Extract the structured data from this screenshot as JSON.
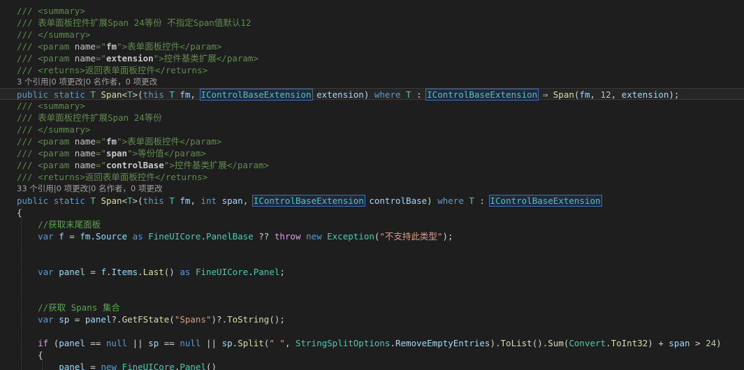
{
  "lines": [
    {
      "kind": "code",
      "tokens": [
        [
          "doc",
          "/// "
        ],
        [
          "tag",
          "<summary>"
        ]
      ]
    },
    {
      "kind": "code",
      "tokens": [
        [
          "doc",
          "/// 表单面板控件扩展Span 24等份 不指定Span值默认12"
        ]
      ]
    },
    {
      "kind": "code",
      "tokens": [
        [
          "doc",
          "/// "
        ],
        [
          "tag",
          "</summary>"
        ]
      ]
    },
    {
      "kind": "code",
      "tokens": [
        [
          "doc",
          "/// "
        ],
        [
          "tag",
          "<param "
        ],
        [
          "attr",
          "name"
        ],
        [
          "q",
          "=\""
        ],
        [
          "aval",
          "fm"
        ],
        [
          "q",
          "\""
        ],
        [
          "tag",
          ">"
        ],
        [
          "doc",
          "表单面板控件"
        ],
        [
          "tag",
          "</param>"
        ]
      ]
    },
    {
      "kind": "code",
      "tokens": [
        [
          "doc",
          "/// "
        ],
        [
          "tag",
          "<param "
        ],
        [
          "attr",
          "name"
        ],
        [
          "q",
          "=\""
        ],
        [
          "aval",
          "extension"
        ],
        [
          "q",
          "\""
        ],
        [
          "tag",
          ">"
        ],
        [
          "doc",
          "控件基类扩展"
        ],
        [
          "tag",
          "</param>"
        ]
      ]
    },
    {
      "kind": "code",
      "tokens": [
        [
          "doc",
          "/// "
        ],
        [
          "tag",
          "<returns>"
        ],
        [
          "doc",
          "返回表单面板控件"
        ],
        [
          "tag",
          "</returns>"
        ]
      ]
    },
    {
      "kind": "lens",
      "text": "3 个引用|0 项更改|0 名作者，0 项更改"
    },
    {
      "kind": "code",
      "current": true,
      "tokens": [
        [
          "kw",
          "public"
        ],
        [
          "pl",
          " "
        ],
        [
          "kw",
          "static"
        ],
        [
          "pl",
          " "
        ],
        [
          "ty",
          "T"
        ],
        [
          "pl",
          " "
        ],
        [
          "m",
          "Span"
        ],
        [
          "pl",
          "<"
        ],
        [
          "ty",
          "T"
        ],
        [
          "pl",
          ">("
        ],
        [
          "kw",
          "this"
        ],
        [
          "pl",
          " "
        ],
        [
          "ty",
          "T"
        ],
        [
          "pl",
          " "
        ],
        [
          "id",
          "fm"
        ],
        [
          "pl",
          ", "
        ],
        [
          "hl",
          "IControlBaseExtension"
        ],
        [
          "pl",
          " "
        ],
        [
          "id",
          "extension"
        ],
        [
          "pl",
          ") "
        ],
        [
          "kw",
          "where"
        ],
        [
          "pl",
          " "
        ],
        [
          "ty",
          "T"
        ],
        [
          "pl",
          " : "
        ],
        [
          "hl",
          "IControlBaseExtension"
        ],
        [
          "pl",
          " ⇒ "
        ],
        [
          "m",
          "Span"
        ],
        [
          "pl",
          "("
        ],
        [
          "id",
          "fm"
        ],
        [
          "pl",
          ", "
        ],
        [
          "num",
          "12"
        ],
        [
          "pl",
          ", "
        ],
        [
          "id",
          "extension"
        ],
        [
          "pl",
          ");"
        ]
      ]
    },
    {
      "kind": "code",
      "tokens": [
        [
          "doc",
          "/// "
        ],
        [
          "tag",
          "<summary>"
        ]
      ]
    },
    {
      "kind": "code",
      "tokens": [
        [
          "doc",
          "/// 表单面板控件扩展Span 24等份"
        ]
      ]
    },
    {
      "kind": "code",
      "tokens": [
        [
          "doc",
          "/// "
        ],
        [
          "tag",
          "</summary>"
        ]
      ]
    },
    {
      "kind": "code",
      "tokens": [
        [
          "doc",
          "/// "
        ],
        [
          "tag",
          "<param "
        ],
        [
          "attr",
          "name"
        ],
        [
          "q",
          "=\""
        ],
        [
          "aval",
          "fm"
        ],
        [
          "q",
          "\""
        ],
        [
          "tag",
          ">"
        ],
        [
          "doc",
          "表单面板控件"
        ],
        [
          "tag",
          "</param>"
        ]
      ]
    },
    {
      "kind": "code",
      "tokens": [
        [
          "doc",
          "/// "
        ],
        [
          "tag",
          "<param "
        ],
        [
          "attr",
          "name"
        ],
        [
          "q",
          "=\""
        ],
        [
          "aval",
          "span"
        ],
        [
          "q",
          "\""
        ],
        [
          "tag",
          ">"
        ],
        [
          "doc",
          "等份值"
        ],
        [
          "tag",
          "</param>"
        ]
      ]
    },
    {
      "kind": "code",
      "tokens": [
        [
          "doc",
          "/// "
        ],
        [
          "tag",
          "<param "
        ],
        [
          "attr",
          "name"
        ],
        [
          "q",
          "=\""
        ],
        [
          "aval",
          "controlBase"
        ],
        [
          "q",
          "\""
        ],
        [
          "tag",
          ">"
        ],
        [
          "doc",
          "控件基类扩展"
        ],
        [
          "tag",
          "</param>"
        ]
      ]
    },
    {
      "kind": "code",
      "tokens": [
        [
          "doc",
          "/// "
        ],
        [
          "tag",
          "<returns>"
        ],
        [
          "doc",
          "返回表单面板控件"
        ],
        [
          "tag",
          "</returns>"
        ]
      ]
    },
    {
      "kind": "lens",
      "text": "33 个引用|0 项更改|0 名作者，0 项更改"
    },
    {
      "kind": "code",
      "tokens": [
        [
          "kw",
          "public"
        ],
        [
          "pl",
          " "
        ],
        [
          "kw",
          "static"
        ],
        [
          "pl",
          " "
        ],
        [
          "ty",
          "T"
        ],
        [
          "pl",
          " "
        ],
        [
          "m",
          "Span"
        ],
        [
          "pl",
          "<"
        ],
        [
          "ty",
          "T"
        ],
        [
          "pl",
          ">("
        ],
        [
          "kw",
          "this"
        ],
        [
          "pl",
          " "
        ],
        [
          "ty",
          "T"
        ],
        [
          "pl",
          " "
        ],
        [
          "id",
          "fm"
        ],
        [
          "pl",
          ", "
        ],
        [
          "kw",
          "int"
        ],
        [
          "pl",
          " "
        ],
        [
          "id",
          "span"
        ],
        [
          "pl",
          ", "
        ],
        [
          "hl",
          "IControlBaseExtension"
        ],
        [
          "pl",
          " "
        ],
        [
          "id",
          "controlBase"
        ],
        [
          "pl",
          ") "
        ],
        [
          "kw",
          "where"
        ],
        [
          "pl",
          " "
        ],
        [
          "ty",
          "T"
        ],
        [
          "pl",
          " : "
        ],
        [
          "hl",
          "IControlBaseExtension"
        ]
      ]
    },
    {
      "kind": "code",
      "tokens": [
        [
          "pl",
          "{"
        ]
      ]
    },
    {
      "kind": "code",
      "tokens": [
        [
          "pl",
          "    "
        ],
        [
          "cm",
          "//获取末尾面板"
        ]
      ]
    },
    {
      "kind": "code",
      "tokens": [
        [
          "pl",
          "    "
        ],
        [
          "kw",
          "var"
        ],
        [
          "pl",
          " "
        ],
        [
          "id",
          "f"
        ],
        [
          "pl",
          " = "
        ],
        [
          "id",
          "fm"
        ],
        [
          "pl",
          "."
        ],
        [
          "id",
          "Source"
        ],
        [
          "pl",
          " "
        ],
        [
          "kw",
          "as"
        ],
        [
          "pl",
          " "
        ],
        [
          "ty",
          "FineUICore"
        ],
        [
          "pl",
          "."
        ],
        [
          "ty",
          "PanelBase"
        ],
        [
          "pl",
          " ?? "
        ],
        [
          "ctl",
          "throw"
        ],
        [
          "pl",
          " "
        ],
        [
          "kw",
          "new"
        ],
        [
          "pl",
          " "
        ],
        [
          "ty",
          "Exception"
        ],
        [
          "pl",
          "("
        ],
        [
          "str",
          "\"不支持此类型\""
        ],
        [
          "pl",
          ");"
        ]
      ]
    },
    {
      "kind": "code",
      "tokens": []
    },
    {
      "kind": "code",
      "tokens": []
    },
    {
      "kind": "code",
      "tokens": [
        [
          "pl",
          "    "
        ],
        [
          "kw",
          "var"
        ],
        [
          "pl",
          " "
        ],
        [
          "id",
          "panel"
        ],
        [
          "pl",
          " = "
        ],
        [
          "id",
          "f"
        ],
        [
          "pl",
          "."
        ],
        [
          "id",
          "Items"
        ],
        [
          "pl",
          "."
        ],
        [
          "m",
          "Last"
        ],
        [
          "pl",
          "() "
        ],
        [
          "kw",
          "as"
        ],
        [
          "pl",
          " "
        ],
        [
          "ty",
          "FineUICore"
        ],
        [
          "pl",
          "."
        ],
        [
          "ty",
          "Panel"
        ],
        [
          "pl",
          ";"
        ]
      ]
    },
    {
      "kind": "code",
      "tokens": []
    },
    {
      "kind": "code",
      "tokens": []
    },
    {
      "kind": "code",
      "tokens": [
        [
          "pl",
          "    "
        ],
        [
          "cm",
          "//获取 Spans 集合"
        ]
      ]
    },
    {
      "kind": "code",
      "tokens": [
        [
          "pl",
          "    "
        ],
        [
          "kw",
          "var"
        ],
        [
          "pl",
          " "
        ],
        [
          "id",
          "sp"
        ],
        [
          "pl",
          " = "
        ],
        [
          "id",
          "panel"
        ],
        [
          "pl",
          "?."
        ],
        [
          "m",
          "GetFState"
        ],
        [
          "pl",
          "("
        ],
        [
          "str",
          "\"Spans\""
        ],
        [
          "pl",
          ")?."
        ],
        [
          "m",
          "ToString"
        ],
        [
          "pl",
          "();"
        ]
      ]
    },
    {
      "kind": "code",
      "tokens": []
    },
    {
      "kind": "code",
      "tokens": [
        [
          "pl",
          "    "
        ],
        [
          "ctl",
          "if"
        ],
        [
          "pl",
          " ("
        ],
        [
          "id",
          "panel"
        ],
        [
          "pl",
          " == "
        ],
        [
          "kw",
          "null"
        ],
        [
          "pl",
          " || "
        ],
        [
          "id",
          "sp"
        ],
        [
          "pl",
          " == "
        ],
        [
          "kw",
          "null"
        ],
        [
          "pl",
          " || "
        ],
        [
          "id",
          "sp"
        ],
        [
          "pl",
          "."
        ],
        [
          "m",
          "Split"
        ],
        [
          "pl",
          "("
        ],
        [
          "str",
          "\" \""
        ],
        [
          "pl",
          ", "
        ],
        [
          "ty",
          "StringSplitOptions"
        ],
        [
          "pl",
          "."
        ],
        [
          "id",
          "RemoveEmptyEntries"
        ],
        [
          "pl",
          ")."
        ],
        [
          "m",
          "ToList"
        ],
        [
          "pl",
          "()."
        ],
        [
          "m",
          "Sum"
        ],
        [
          "pl",
          "("
        ],
        [
          "ty",
          "Convert"
        ],
        [
          "pl",
          "."
        ],
        [
          "m",
          "ToInt32"
        ],
        [
          "pl",
          ") + "
        ],
        [
          "id",
          "span"
        ],
        [
          "pl",
          " > "
        ],
        [
          "num",
          "24"
        ],
        [
          "pl",
          ")"
        ]
      ]
    },
    {
      "kind": "code",
      "tokens": [
        [
          "pl",
          "    {"
        ]
      ]
    },
    {
      "kind": "code",
      "tokens": [
        [
          "pl",
          "        "
        ],
        [
          "id",
          "panel"
        ],
        [
          "pl",
          " = "
        ],
        [
          "kw",
          "new"
        ],
        [
          "pl",
          " "
        ],
        [
          "ty",
          "FineUICore"
        ],
        [
          "pl",
          "."
        ],
        [
          "ty",
          "Panel"
        ],
        [
          "pl",
          "()"
        ]
      ]
    }
  ]
}
